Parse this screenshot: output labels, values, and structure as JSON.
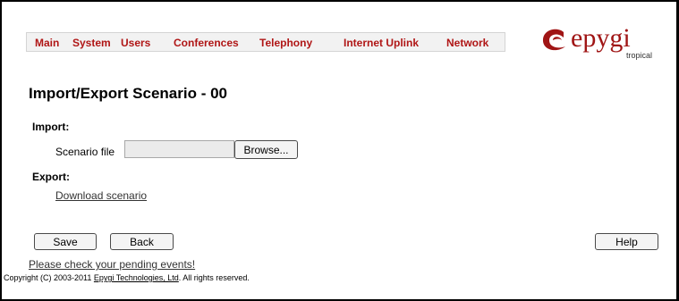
{
  "nav": {
    "items": [
      "Main",
      "System",
      "Users",
      "Conferences",
      "Telephony",
      "Internet Uplink",
      "Network"
    ]
  },
  "logo": {
    "brand": "epygi",
    "sub": "tropical"
  },
  "page": {
    "title": "Import/Export Scenario - 00"
  },
  "import": {
    "label": "Import:",
    "field_label": "Scenario file",
    "file_value": "",
    "browse_label": "Browse..."
  },
  "export": {
    "label": "Export:",
    "download_link": "Download scenario"
  },
  "actions": {
    "save": "Save",
    "back": "Back",
    "help": "Help"
  },
  "pending_link": "Please check your pending events!",
  "footer": {
    "prefix": "Copyright (C) 2003-2011 ",
    "company": "Epygi Technologies, Ltd",
    "suffix": ". All rights reserved."
  },
  "colors": {
    "nav_text": "#b01616",
    "logo": "#a01515"
  }
}
